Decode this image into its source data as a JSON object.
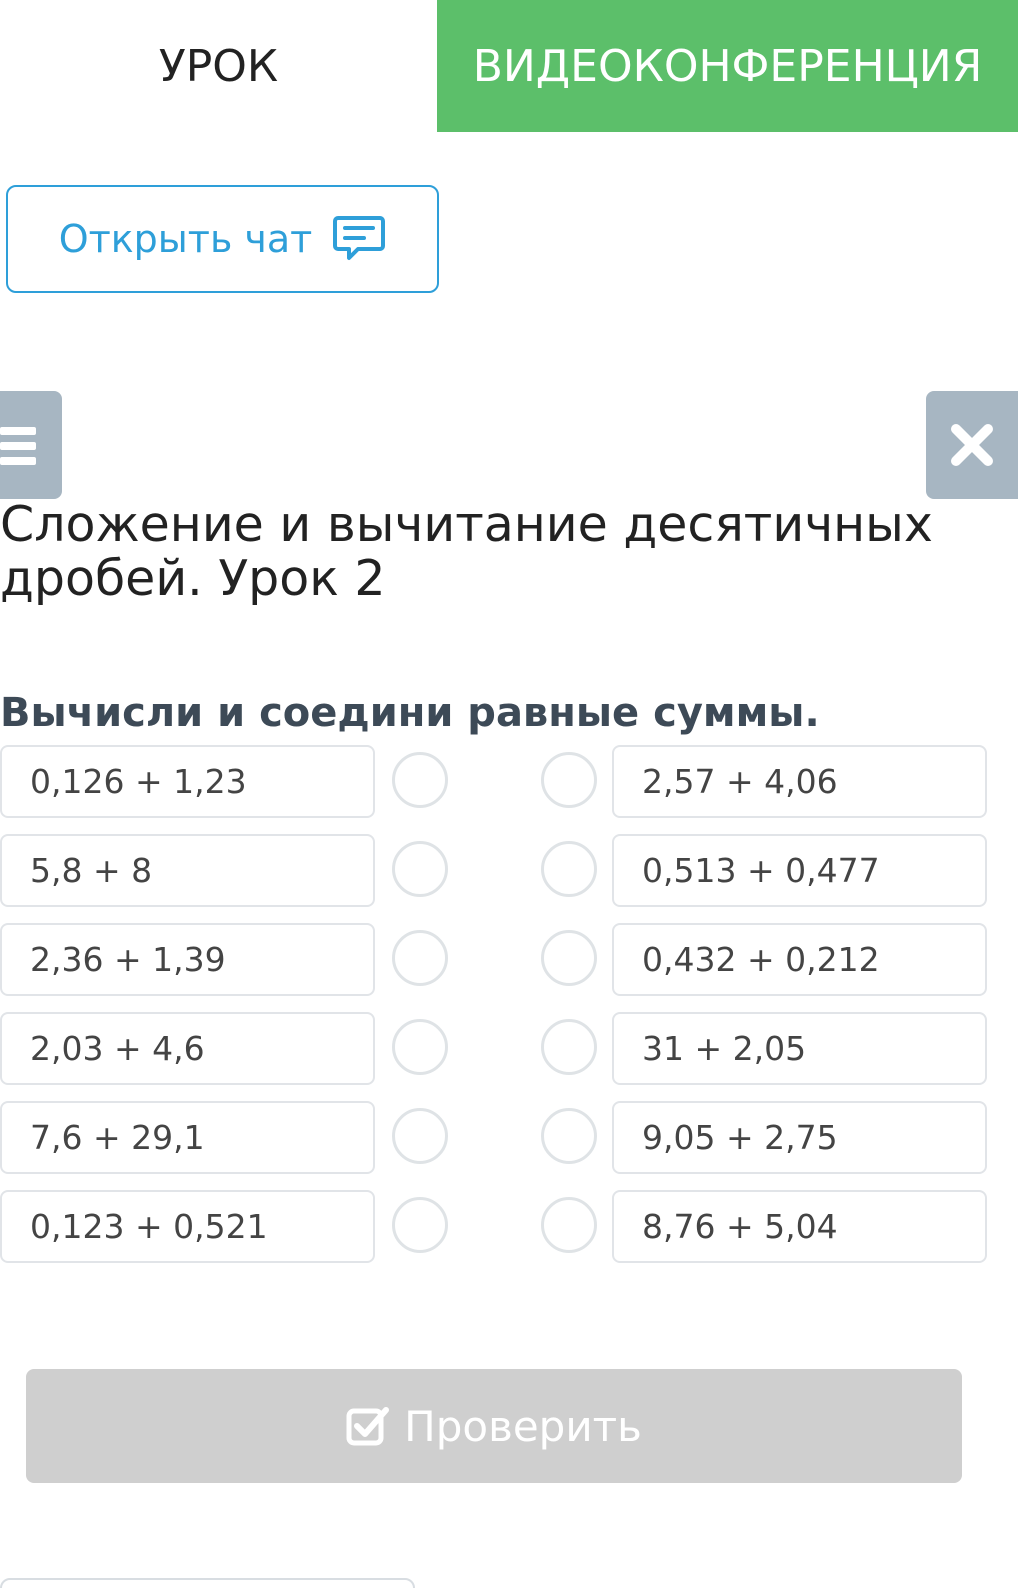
{
  "tabs": {
    "lesson": "УРОК",
    "video": "ВИДЕОКОНФЕРЕНЦИЯ"
  },
  "chat": {
    "label": "Открыть чат",
    "icon": "chat-icon"
  },
  "lesson_title": "Сложение и вычитание десятичных дробей. Урок 2",
  "instruction": "Вычисли и соедини равные суммы.",
  "left_items": [
    "0,126 + 1,23",
    "5,8 + 8",
    "2,36 + 1,39",
    "2,03 + 4,6",
    "7,6 + 29,1",
    "0,123 + 0,521"
  ],
  "right_items": [
    "2,57 + 4,06",
    "0,513 + 0,477",
    "0,432 + 0,212",
    "31 + 2,05",
    "9,05 + 2,75",
    "8,76 + 5,04"
  ],
  "check_button": {
    "label": "Проверить",
    "icon": "checkbox-icon"
  },
  "colors": {
    "accent_green": "#5cbf6a",
    "accent_blue": "#2e9fd9",
    "button_gray": "#cfcfcf",
    "control_gray": "#a7b6c2"
  }
}
